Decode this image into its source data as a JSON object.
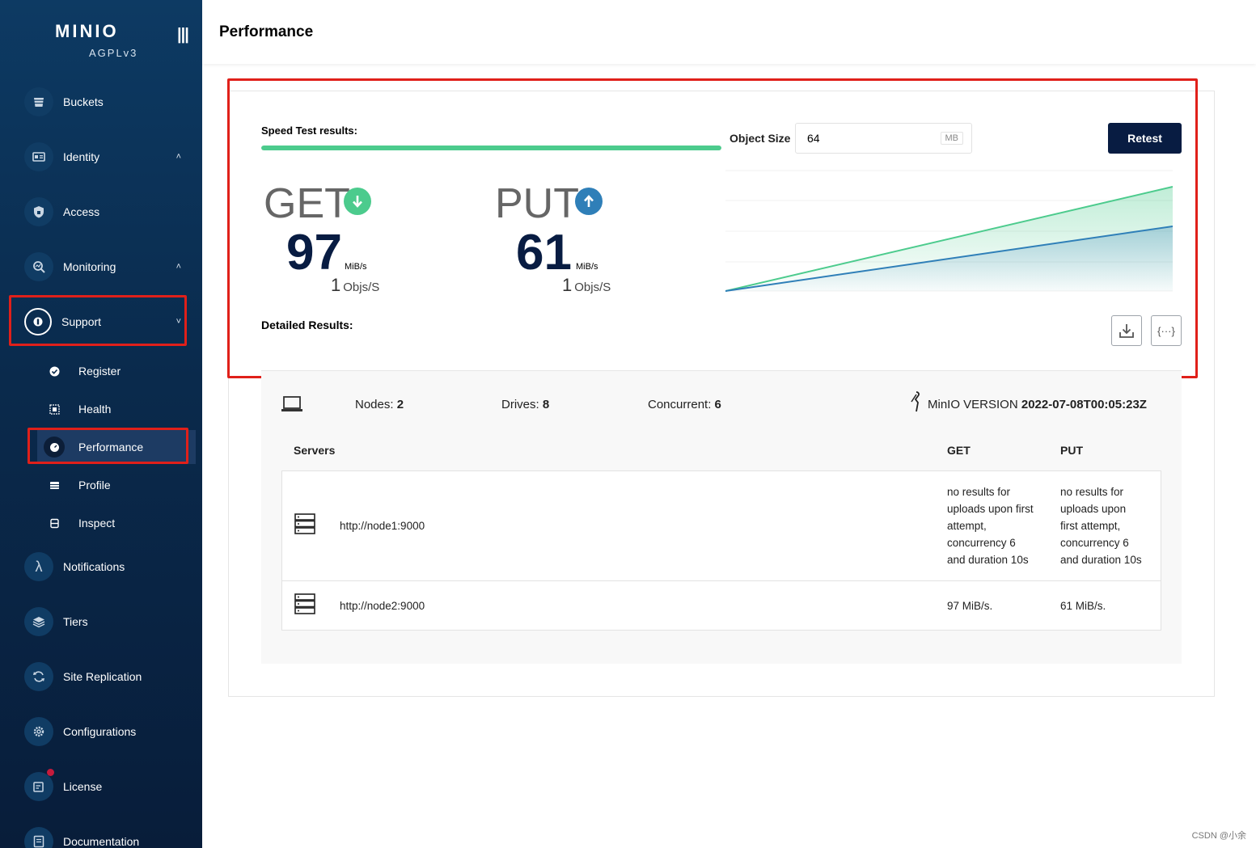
{
  "app": {
    "logo": "MINIO",
    "license_tag": "AGPLv3",
    "collapse_icon": "menu-bars-icon"
  },
  "sidebar": {
    "items": [
      {
        "label": "Buckets",
        "icon": "bucket-icon"
      },
      {
        "label": "Identity",
        "icon": "id-card-icon",
        "chevron": "˄"
      },
      {
        "label": "Access",
        "icon": "shield-lock-icon"
      },
      {
        "label": "Monitoring",
        "icon": "search-chart-icon",
        "chevron": "˄"
      },
      {
        "label": "Support",
        "icon": "support-icon",
        "chevron": "˅"
      },
      {
        "label": "Notifications",
        "icon": "lambda-icon"
      },
      {
        "label": "Tiers",
        "icon": "layers-icon"
      },
      {
        "label": "Site Replication",
        "icon": "sync-icon"
      },
      {
        "label": "Configurations",
        "icon": "gear-icon"
      },
      {
        "label": "License",
        "icon": "license-icon"
      },
      {
        "label": "Documentation",
        "icon": "document-icon"
      }
    ],
    "support_sub": [
      {
        "label": "Register",
        "icon": "check-badge-icon"
      },
      {
        "label": "Health",
        "icon": "health-grid-icon"
      },
      {
        "label": "Performance",
        "icon": "speedometer-icon"
      },
      {
        "label": "Profile",
        "icon": "profile-stack-icon"
      },
      {
        "label": "Inspect",
        "icon": "inspect-icon"
      }
    ]
  },
  "header": {
    "title": "Performance"
  },
  "speedtest": {
    "results_label": "Speed Test results:",
    "progress_percent": 100,
    "object_size_label": "Object Size",
    "object_size_value": "64",
    "object_size_unit": "MB",
    "retest_label": "Retest",
    "get": {
      "label": "GET",
      "value": "97",
      "unit": "MiB/s",
      "objs": "1",
      "objs_unit": "Objs/S",
      "icon": "arrow-down-circle-icon"
    },
    "put": {
      "label": "PUT",
      "value": "61",
      "unit": "MiB/s",
      "objs": "1",
      "objs_unit": "Objs/S",
      "icon": "arrow-up-circle-icon"
    },
    "detailed_label": "Detailed Results:",
    "download_icon": "download-icon",
    "json_icon": "json-braces-icon",
    "colors": {
      "get": "#4ccb8d",
      "put": "#2f7fb8",
      "retest_bg": "#081c42"
    }
  },
  "info": {
    "computer_icon": "laptop-icon",
    "nodes_label": "Nodes:",
    "nodes_value": "2",
    "drives_label": "Drives:",
    "drives_value": "8",
    "concurrent_label": "Concurrent:",
    "concurrent_value": "6",
    "version_icon": "minio-bird-icon",
    "version_label": "MinIO VERSION",
    "version_value": "2022-07-08T00:05:23Z"
  },
  "servers_table": {
    "headers": [
      "Servers",
      "GET",
      "PUT"
    ],
    "rows": [
      {
        "server": "http://node1:9000",
        "get": [
          "no results for",
          "uploads upon first",
          "attempt,",
          "concurrency 6",
          "and duration 10s"
        ],
        "put": [
          "no results for",
          "uploads upon",
          "first attempt,",
          "concurrency 6",
          "and duration 10s"
        ]
      },
      {
        "server": "http://node2:9000",
        "get": [
          "97 MiB/s."
        ],
        "put": [
          "61 MiB/s."
        ]
      }
    ]
  },
  "watermark": "CSDN @小余"
}
